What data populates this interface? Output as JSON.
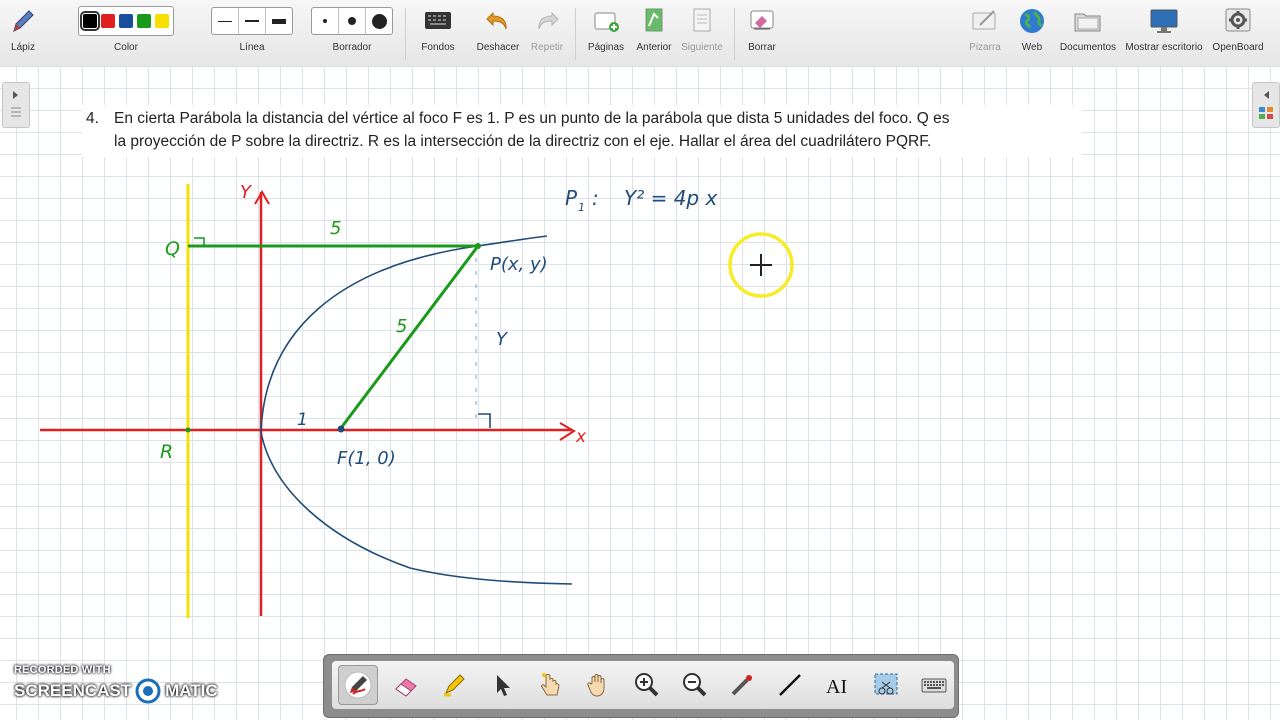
{
  "toolbar": {
    "pen_label": "Lápiz",
    "color_label": "Color",
    "line_label": "Línea",
    "eraser_label": "Borrador",
    "backgrounds_label": "Fondos",
    "undo_label": "Deshacer",
    "redo_label": "Repetir",
    "pages_label": "Páginas",
    "previous_label": "Anterior",
    "next_label": "Siguiente",
    "clear_label": "Borrar",
    "board_label": "Pizarra",
    "web_label": "Web",
    "documents_label": "Documentos",
    "desktop_label": "Mostrar escritorio",
    "openboard_label": "OpenBoard",
    "colors": [
      "#000000",
      "#e02020",
      "#1a4fa0",
      "#1a9a1a",
      "#f5e000"
    ],
    "selected_color": 0
  },
  "problem": {
    "number": "4.",
    "line1": "En cierta Parábola la distancia del vértice al foco F es 1.  P  es un punto de la parábola que dista 5 unidades del foco. Q es",
    "line2": "la proyección de P sobre la directriz. R es la intersección de la directriz con el eje. Hallar el área del cuadrilátero PQRF."
  },
  "handwriting": {
    "y_axis": "Y",
    "x_axis": "x",
    "q_label": "Q",
    "r_label": "R",
    "five_top": "5",
    "five_diag": "5",
    "y_height": "Y",
    "one": "1",
    "p_point": "P(x, y)",
    "f_point": "F(1, 0)",
    "equation_lhs": "P",
    "equation_sub": "1",
    "equation_rhs": "Y² = 4p x"
  },
  "colors": {
    "red_axis": "#e02020",
    "green_line": "#1a9a1a",
    "blue_curve": "#1f4c7a",
    "directrix": "#f2e200",
    "cursor_ring": "#f5ec2a"
  },
  "watermark": {
    "line1": "RECORDED WITH",
    "brand_left": "SCREENCAST",
    "brand_right": "MATIC"
  }
}
